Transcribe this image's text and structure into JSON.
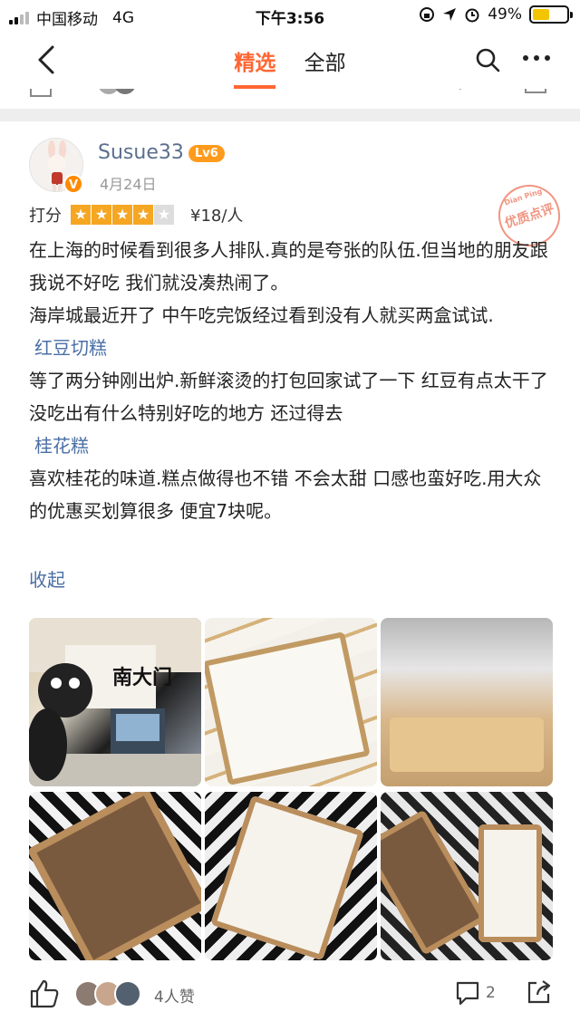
{
  "status_bar": {
    "carrier": "中国移动",
    "network": "4G",
    "time": "下午3:56",
    "battery_percent": "49%",
    "battery_level": 0.49
  },
  "nav": {
    "tabs": [
      {
        "label": "精选",
        "active": true
      },
      {
        "label": "全部",
        "active": false
      }
    ],
    "accent_color": "#ff6633"
  },
  "review": {
    "username": "Susue33",
    "level": "Lv6",
    "verified_badge": "V",
    "date": "4月24日",
    "rating_label": "打分",
    "rating_stars": 4,
    "rating_max": 5,
    "price": "¥18/人",
    "quality_stamp": "优质点评",
    "stamp_small": "Dian Ping",
    "paragraphs": [
      "在上海的时候看到很多人排队.真的是夸张的队伍.但当地的朋友跟我说不好吃 我们就没凑热闹了。",
      "海岸城最近开了 中午吃完饭经过看到没有人就买两盒试试."
    ],
    "tag1": "红豆切糕",
    "paragraph3": "等了两分钟刚出炉.新鲜滚烫的打包回家试了一下 红豆有点太干了 没吃出有什么特别好吃的地方 还过得去",
    "tag2": "桂花糕",
    "paragraph4": "喜欢桂花的味道.糕点做得也不错 不会太甜 口感也蛮好吃.用大众的优惠买划算很多 便宜7块呢。",
    "collapse_label": "收起",
    "store_sign": "南大门",
    "photos": [
      "store-front-photo",
      "osmanthus-cake-photo",
      "display-case-photo",
      "red-bean-cake-photo",
      "osmanthus-cake-tray-photo",
      "two-cakes-photo"
    ]
  },
  "actions": {
    "like_count": "4人赞",
    "comment_count": "2"
  }
}
